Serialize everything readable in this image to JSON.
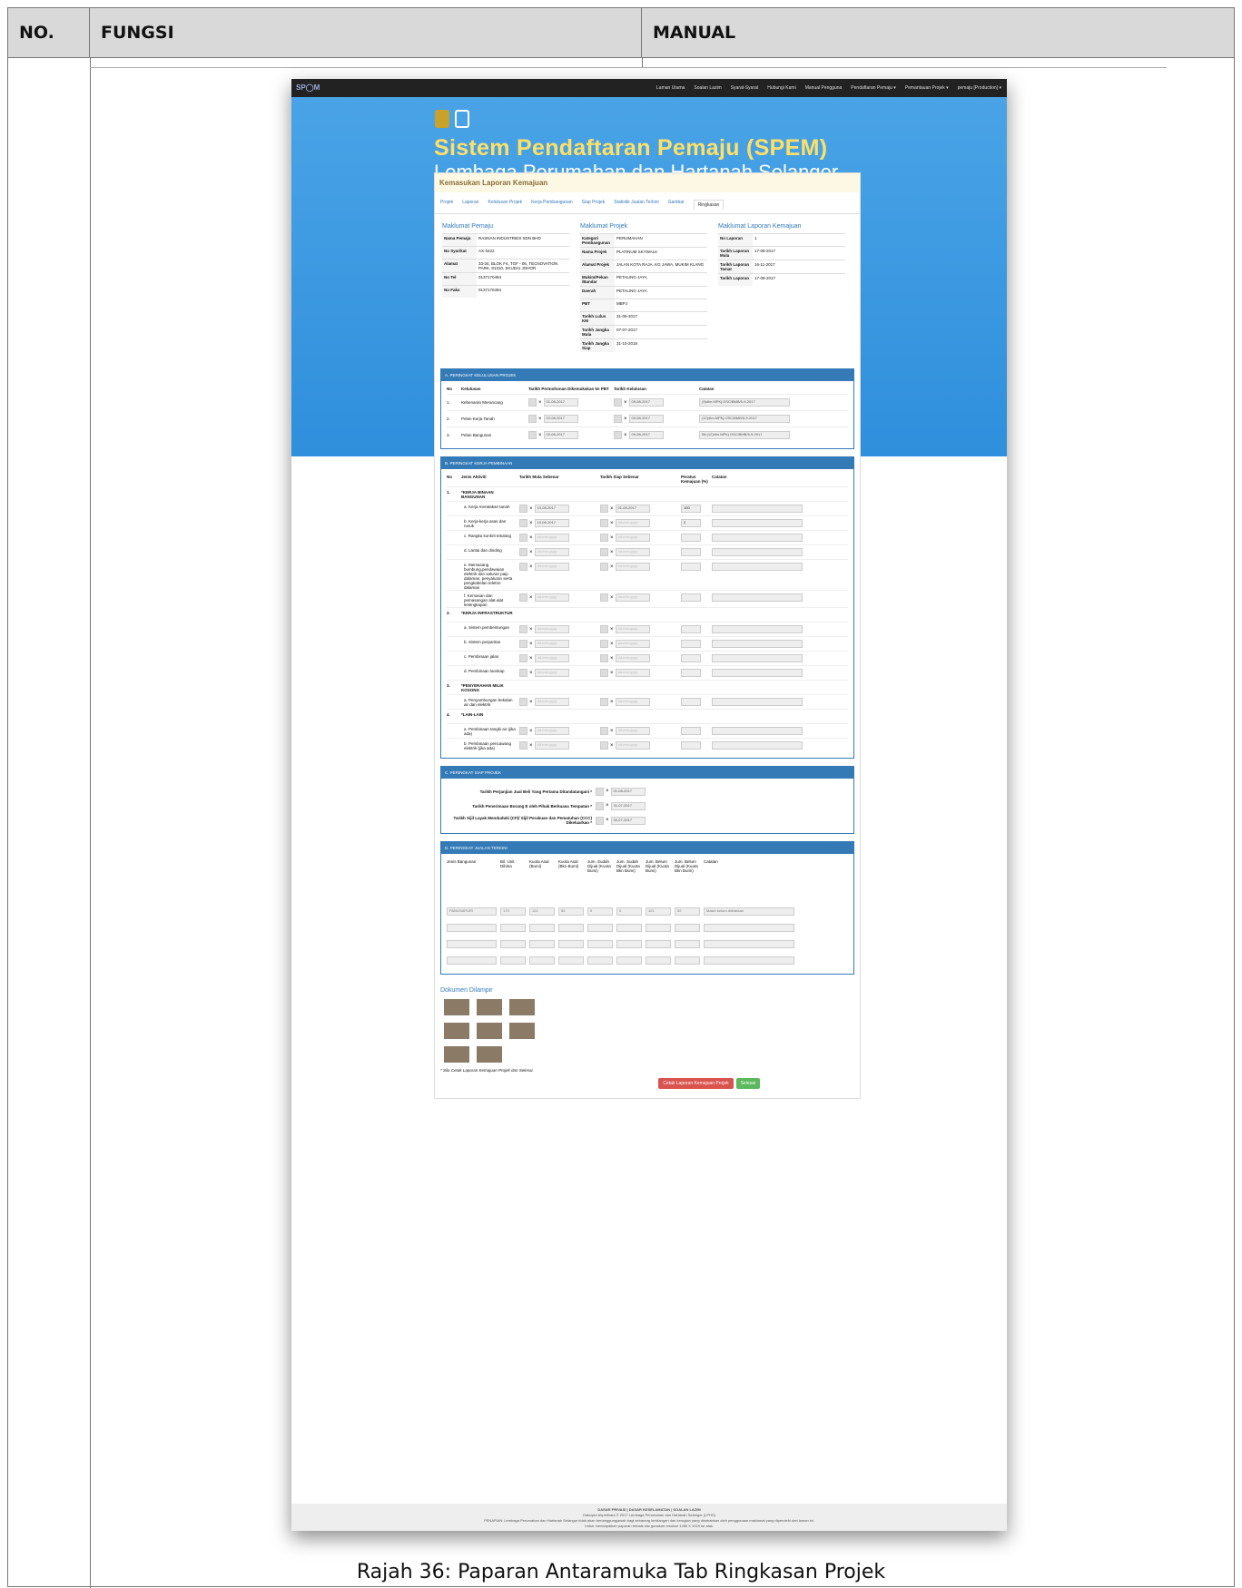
{
  "table": {
    "col_no": "NO.",
    "col_fungsi": "FUNGSI",
    "col_manual": "MANUAL"
  },
  "screenshot": {
    "brand": "SP◯M",
    "nav": [
      "Laman Utama",
      "Soalan Lazim",
      "Syarat-Syarat",
      "Hubungi Kami",
      "Manual Pengguna",
      "Pendaftaran Pemaju ▾",
      "Pemantauan Projek ▾",
      "pemaju [Production] ▾"
    ],
    "title": "Sistem Pendaftaran Pemaju (SPEM)",
    "subtitle": "Lembaga Perumahan dan Hartanah Selangor",
    "panel_title": "Kemasukan Laporan Kemajuan",
    "tabs": [
      "Projek",
      "Laporan",
      "Kelulusan Projek",
      "Kerja Pembangunan",
      "Siap Projek",
      "Statistik Jualan Terkini",
      "Gambar",
      "Ringkasan"
    ],
    "pemaju": {
      "heading": "Maklumat Pemaju",
      "rows": [
        [
          "Nama Pemaju",
          "RASNAN INDUSTRIES SDN BHD"
        ],
        [
          "No Syarikat",
          "AX-3422"
        ],
        [
          "Alamat",
          "33-34, BLOK F4, TGF - 06, TECNOVATION PARK, 81310, SKUDAI JOHOR"
        ],
        [
          "No Tel",
          "0137170494"
        ],
        [
          "No Faks",
          "0137170494"
        ]
      ]
    },
    "projek": {
      "heading": "Maklumat Projek",
      "rows": [
        [
          "Kategori Pembangunan",
          "PERUMAHAN"
        ],
        [
          "Nama Projek",
          "PLATINUM SKYWALK"
        ],
        [
          "Alamat Projek",
          "JALAN KOTA RAJA, KG JAWA, MUKIM KLANG"
        ],
        [
          "Mukim/Pekan /Bandar",
          "PETALING JAYA"
        ],
        [
          "Daerah",
          "PETALING JAYA"
        ],
        [
          "PBT",
          "MBPJ"
        ],
        [
          "Tarikh Lulus KM",
          "31-05-2017"
        ],
        [
          "Tarikh Jangka Mula",
          "07-07-2017"
        ],
        [
          "Tarikh Jangka Siap",
          "31-10-2018"
        ]
      ]
    },
    "laporan": {
      "heading": "Maklumat Laporan Kemajuan",
      "rows": [
        [
          "No Laporan",
          "1"
        ],
        [
          "Tarikh Laporan Mula",
          "17-08-2017"
        ],
        [
          "Tarikh Laporan Tamat",
          "16-11-2017"
        ],
        [
          "Tarikh Laporan",
          "17-08-2017"
        ]
      ]
    },
    "sect_a": {
      "title": "A. PERINGKAT KELULUSAN PROJEK",
      "head": [
        "No",
        "Kelulusan",
        "Tarikh Permohonan Dikemukakan ke PBT",
        "Tarikh Kelulusan",
        "Catatan"
      ],
      "rows": [
        [
          "1.",
          "Kebenaran Merancang",
          "01-08-2017",
          "09-08-2017",
          "(9)dlm.MPKj.OSC/BMB/5-9-2017"
        ],
        [
          "2.",
          "Pelan Kerja Tanah",
          "02-08-2017",
          "09-08-2017",
          "(12)dlm.MPKj.OSC/BMB/5-9-2017"
        ],
        [
          "3.",
          "Pelan Bangunan",
          "02-08-2017",
          "09-08-2017",
          "Bil.(12)dlm.MPKj.OSC/BMB/5-9-2017"
        ]
      ]
    },
    "sect_b": {
      "title": "B. PERINGKAT KERJA PEMBINAAN",
      "head": [
        "No",
        "Jenis Aktiviti",
        "Tarikh Mula Sebenar",
        "Tarikh Siap Sebenar",
        "Peratus Kemajuan (%)",
        "Catatan"
      ],
      "rows": [
        [
          "1.",
          "*KERJA BINAAN BANGUNAN",
          "",
          "",
          ""
        ],
        [
          "",
          "a. Kerja meratakan tanah",
          "10-08-2017",
          "01-08-2017",
          "100"
        ],
        [
          "",
          "b. Kerja-kerja asas dan rusuk",
          "15-08-2017",
          "dd-mm-yyyy",
          "2"
        ],
        [
          "",
          "c. Rangka konkrit tetulang",
          "dd-mm-yyyy",
          "dd-mm-yyyy",
          ""
        ],
        [
          "",
          "d. Lantai dan dinding",
          "dd-mm-yyyy",
          "dd-mm-yyyy",
          ""
        ],
        [
          "",
          "e. Memasang bumbung,pendawaian elektrik dan saluran paip dalaman, penyaluran serta pengkabelan telefon dalaman",
          "dd-mm-yyyy",
          "dd-mm-yyyy",
          ""
        ],
        [
          "",
          "f. Kemasan dan pemasangan alat-alat kelengkapan",
          "dd-mm-yyyy",
          "dd-mm-yyyy",
          ""
        ],
        [
          "2.",
          "*KERJA INFRASTRUKTUR",
          "",
          "",
          ""
        ],
        [
          "",
          "a. Sistem pembentungan",
          "dd-mm-yyyy",
          "dd-mm-yyyy",
          ""
        ],
        [
          "",
          "b. Sistem perparitan",
          "dd-mm-yyyy",
          "dd-mm-yyyy",
          ""
        ],
        [
          "",
          "c. Pembinaan jalan",
          "dd-mm-yyyy",
          "dd-mm-yyyy",
          ""
        ],
        [
          "",
          "d. Pembinaan lanskap",
          "dd-mm-yyyy",
          "dd-mm-yyyy",
          ""
        ],
        [
          "3.",
          "*PENYERAHAN MILIK KOSONG",
          "",
          "",
          ""
        ],
        [
          "",
          "a. Penyambungan bekalan air dan elektrik",
          "dd-mm-yyyy",
          "dd-mm-yyyy",
          ""
        ],
        [
          "4.",
          "*LAIN-LAIN",
          "",
          "",
          ""
        ],
        [
          "",
          "a. Pembinaan tangki air (jika ada)",
          "dd-mm-yyyy",
          "dd-mm-yyyy",
          ""
        ],
        [
          "",
          "b. Pembinaan pencawang elektrik (jika ada)",
          "dd-mm-yyyy",
          "dd-mm-yyyy",
          ""
        ]
      ]
    },
    "sect_c": {
      "title": "C. PERINGKAT SIAP PROJEK",
      "rows": [
        [
          "Tarikh Perjanjian Jual Beli Yang Pertama Ditandatangani *",
          "01-08-2017"
        ],
        [
          "Tarikh Penerimaan Borang E oleh Pihak Berkuasa Tempatan *",
          "31-07-2017"
        ],
        [
          "Tarikh Sijil Layak Menduduki (CF)/ Sijil Perakuan dan Pematuhan (CCC) Dikeluarkan *",
          "30-07-2017"
        ]
      ]
    },
    "sect_d": {
      "title": "D. PERINGKAT JUALAN TERKINI",
      "head": [
        "Jenis Bangunan",
        "Bil. Unit Dibina",
        "Kuota Asal (Bumi)",
        "Kuota Asal (Bkn Bumi)",
        "Jum. Sudah Dijual (Kuota Bumi)",
        "Jum. Sudah Dijual (Kuota Bkn Bumi)",
        "Jum. Belum Dijual (Kuota Bumi)",
        "Jum. Belum Dijual (Kuota Bkn Bumi)",
        "Catatan"
      ],
      "row": [
        "PANGSAPURI",
        "173",
        "121",
        "52",
        "0",
        "0",
        "121",
        "52",
        "Masih belum dilelarkan"
      ]
    },
    "dokumen": "Dokumen Dilampir",
    "note": "* Sila Cetak Laporan Kemajuan Projek dan Selesai.",
    "btn_print": "Cetak Laporan Kemajuan Projek",
    "btn_done": "Selesai",
    "footer1": "DASAR PRIVASI | DASAR KESELAMATAN | SOALAN LAZIM",
    "footer2": "Hakcipta terpelihara © 2017 Lembaga Perumahan dan Hartanah Selangor (LPHS)",
    "footer3": "PENAFIAN: Lembaga Perumahan dan Hartanah Selangor tidak akan bertanggungjawab bagi sebarang kehilangan dan kerugian yang disebabkan oleh penggunaan maklumat yang diperolehi dari laman ini.",
    "footer4": "Untuk mendapatkan paparan terbaik sila gunakan resolusi 1280 X 1024 ke atas."
  },
  "caption": "Rajah 36: Paparan Antaramuka Tab Ringkasan Projek"
}
